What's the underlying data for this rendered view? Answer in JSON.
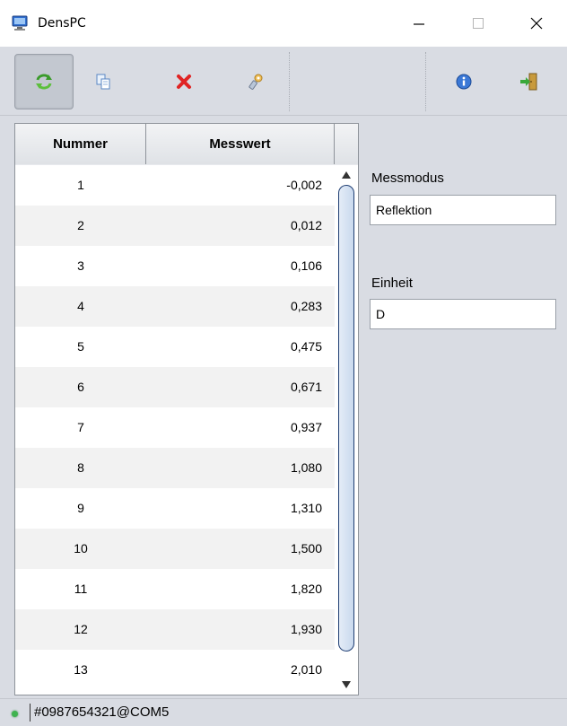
{
  "window": {
    "title": "DensPC",
    "minimize_glyph": "—",
    "maximize_glyph": "☐",
    "close_glyph": "✕"
  },
  "toolbar": {
    "buttons": [
      {
        "icon": "refresh-arrows-icon",
        "active": true
      },
      {
        "icon": "copy-icon",
        "active": false
      },
      {
        "icon": "delete-x-icon",
        "active": false
      },
      {
        "icon": "settings-wrench-icon",
        "active": false
      },
      {
        "icon": "info-icon",
        "active": false
      },
      {
        "icon": "exit-door-icon",
        "active": false
      }
    ]
  },
  "table": {
    "headers": {
      "number": "Nummer",
      "value": "Messwert"
    },
    "rows": [
      {
        "number": "1",
        "value": "-0,002"
      },
      {
        "number": "2",
        "value": "0,012"
      },
      {
        "number": "3",
        "value": "0,106"
      },
      {
        "number": "4",
        "value": "0,283"
      },
      {
        "number": "5",
        "value": "0,475"
      },
      {
        "number": "6",
        "value": "0,671"
      },
      {
        "number": "7",
        "value": "0,937"
      },
      {
        "number": "8",
        "value": "1,080"
      },
      {
        "number": "9",
        "value": "1,310"
      },
      {
        "number": "10",
        "value": "1,500"
      },
      {
        "number": "11",
        "value": "1,820"
      },
      {
        "number": "12",
        "value": "1,930"
      },
      {
        "number": "13",
        "value": "2,010"
      }
    ]
  },
  "fields": {
    "mode_label": "Messmodus",
    "mode_value": "Reflektion",
    "unit_label": "Einheit",
    "unit_value": "D"
  },
  "status": {
    "connection": "#0987654321@COM5",
    "led_color": "#3fb34f"
  }
}
